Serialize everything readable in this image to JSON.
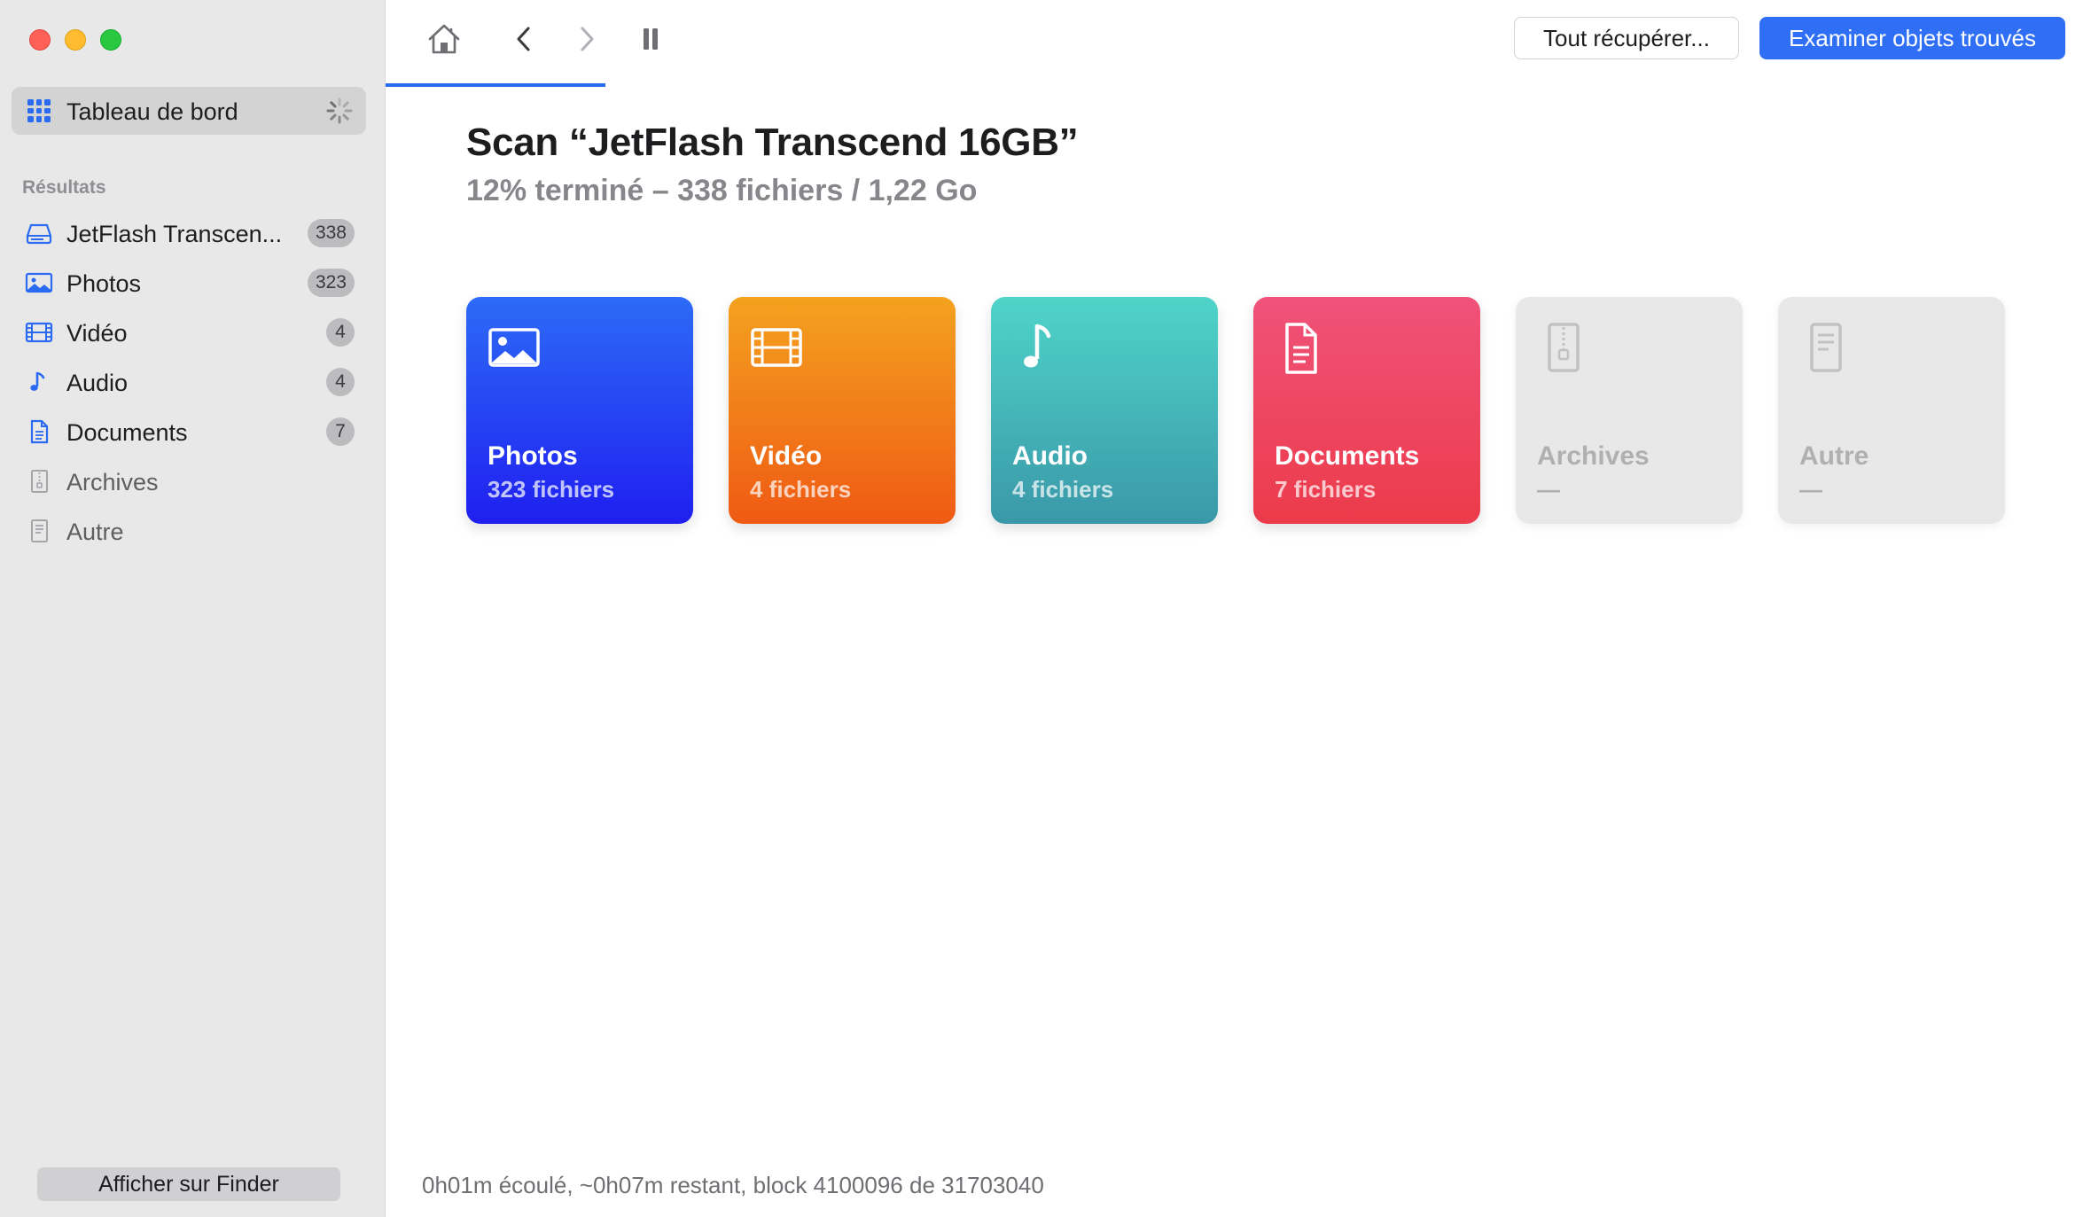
{
  "sidebar": {
    "dashboard_label": "Tableau de bord",
    "section_title": "Résultats",
    "items": [
      {
        "label": "JetFlash Transcen...",
        "count": "338",
        "icon": "drive-icon"
      },
      {
        "label": "Photos",
        "count": "323",
        "icon": "photo-icon"
      },
      {
        "label": "Vidéo",
        "count": "4",
        "icon": "film-icon"
      },
      {
        "label": "Audio",
        "count": "4",
        "icon": "music-note-icon"
      },
      {
        "label": "Documents",
        "count": "7",
        "icon": "document-icon"
      },
      {
        "label": "Archives",
        "count": "",
        "icon": "archive-icon"
      },
      {
        "label": "Autre",
        "count": "",
        "icon": "other-file-icon"
      }
    ],
    "finder_button": "Afficher sur Finder"
  },
  "toolbar": {
    "recover_all": "Tout récupérer...",
    "examine_found": "Examiner objets trouvés"
  },
  "main": {
    "title": "Scan “JetFlash Transcend 16GB”",
    "subtitle": "12% terminé – 338 fichiers / 1,22 Go",
    "progress_percent": 12,
    "cards": [
      {
        "name": "Photos",
        "count": "323 fichiers",
        "icon": "photo-icon",
        "gradient": [
          "#2d6bf7",
          "#1f1ff0"
        ]
      },
      {
        "name": "Vidéo",
        "count": "4 fichiers",
        "icon": "film-icon",
        "gradient": [
          "#f4a21f",
          "#ef5a14"
        ]
      },
      {
        "name": "Audio",
        "count": "4 fichiers",
        "icon": "music-note-icon",
        "gradient": [
          "#4fd4c9",
          "#3a98a8"
        ]
      },
      {
        "name": "Documents",
        "count": "7 fichiers",
        "icon": "document-icon",
        "gradient": [
          "#f0527a",
          "#ec3b4a"
        ]
      },
      {
        "name": "Archives",
        "count": "—",
        "icon": "archive-icon",
        "gradient": null
      },
      {
        "name": "Autre",
        "count": "—",
        "icon": "other-file-icon",
        "gradient": null
      }
    ],
    "status": "0h01m écoulé, ~0h07m restant, block 4100096 de 31703040"
  },
  "colors": {
    "accent": "#2f6ff5",
    "sidebar_icon": "#2a6bf2"
  }
}
